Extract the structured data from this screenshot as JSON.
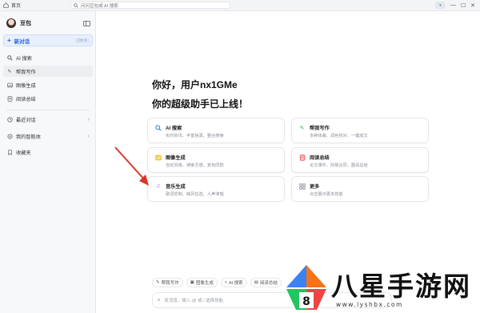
{
  "topbar": {
    "home_label": "首页",
    "search_placeholder": "问问豆包或 AI 搜索",
    "avatar_badge": "▾"
  },
  "sidebar": {
    "bot_name": "豆包",
    "new_chat": {
      "label": "新对话",
      "shortcut": "Ctrl K"
    },
    "items": [
      {
        "label": "AI 搜索",
        "icon": "search-icon"
      },
      {
        "label": "帮我写作",
        "icon": "pen-icon"
      },
      {
        "label": "图像生成",
        "icon": "image-icon"
      },
      {
        "label": "阅读总结",
        "icon": "book-icon"
      }
    ],
    "sections": [
      {
        "label": "最近对话",
        "icon": "clock-icon"
      },
      {
        "label": "我的智能体",
        "icon": "bot-icon"
      },
      {
        "label": "收藏夹",
        "icon": "bookmark-icon"
      }
    ]
  },
  "main": {
    "greeting_line1": "你好，用户nx1GMe",
    "greeting_line2": "你的超级助手已上线！",
    "cards": [
      {
        "title": "AI 搜索",
        "desc": "实时资讯、丰富信源、整合搜索",
        "icon": "search-icon",
        "color": "#3b82f6"
      },
      {
        "title": "帮我写作",
        "desc": "多种体裁、润色校对、一键成文",
        "icon": "pen-icon",
        "color": "#22c55e"
      },
      {
        "title": "图像生成",
        "desc": "自定风格、搜索灵感、复刻同款",
        "icon": "image-icon",
        "color": "#f59e0b"
      },
      {
        "title": "阅读总结",
        "desc": "论文课件、财报合同、翻译总结",
        "icon": "book-icon",
        "color": "#ef4444"
      },
      {
        "title": "音乐生成",
        "desc": "歌词定制、曲风任选、人声演唱",
        "icon": "music-note-icon",
        "color": "#8b5cf6"
      },
      {
        "title": "更多",
        "desc": "点击展示更多技能",
        "icon": "grid-icon",
        "color": "#6b7280"
      }
    ],
    "chips": [
      {
        "label": "帮我写作"
      },
      {
        "label": "图像生成"
      },
      {
        "label": "AI 搜索"
      },
      {
        "label": "阅读总结"
      }
    ],
    "input_placeholder": "发消息、输入 @ 或 / 选择技能"
  },
  "watermark": {
    "text": "八星手游网",
    "url": "www.lyshbx.com"
  }
}
